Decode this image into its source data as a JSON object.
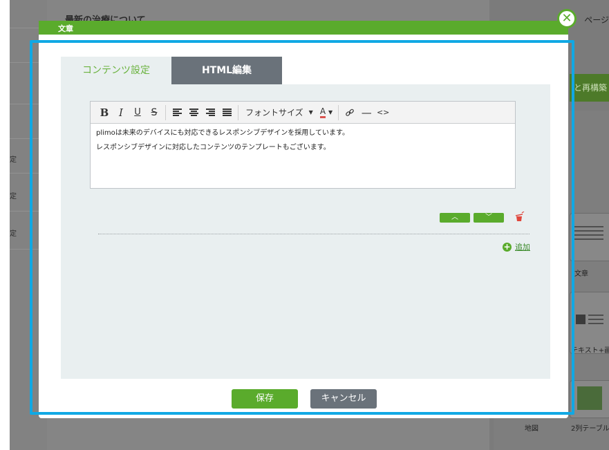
{
  "background": {
    "page_title": "最新の治療について",
    "page_link": "ページ",
    "left_menu": [
      "定",
      "定",
      "定"
    ],
    "green_button": "と再構築",
    "tiles": [
      "文章",
      "テキスト+画像 文章",
      "地図",
      "2列テーブル"
    ]
  },
  "modal": {
    "title": "文章",
    "close_icon": "close-icon",
    "tabs": [
      {
        "label": "コンテンツ設定",
        "active": true
      },
      {
        "label": "HTML編集",
        "active": false
      }
    ],
    "toolbar": {
      "bold": "B",
      "italic": "I",
      "underline": "U",
      "strike": "S",
      "font_size": "フォントサイズ",
      "font_color": "A",
      "link_icon": "link-icon",
      "hr": "—",
      "source": "<>"
    },
    "content_lines": [
      "plimoは未来のデバイスにも対応できるレスポンシブデザインを採用しています。",
      "レスポンシブデザインに対応したコンテンツのテンプレートもございます。"
    ],
    "move_up": "︿",
    "move_down": "﹀",
    "add_label": "追加",
    "save_label": "保存",
    "cancel_label": "キャンセル"
  },
  "colors": {
    "accent_green": "#5aab2c",
    "tab_grey": "#6a727a",
    "focus_blue": "#10a8e4",
    "panel_bg": "#e9eff0"
  }
}
